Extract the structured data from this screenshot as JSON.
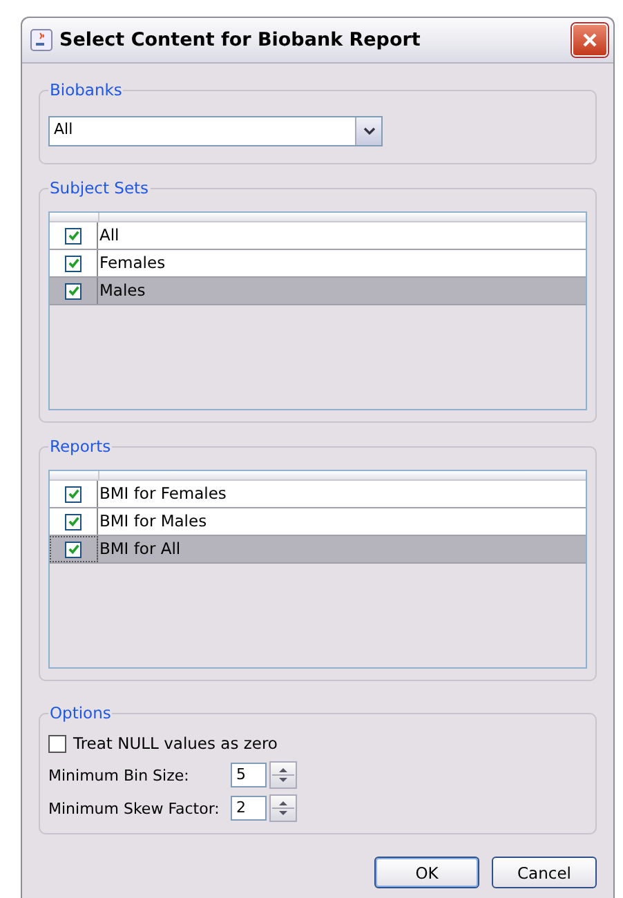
{
  "window": {
    "title": "Select Content for Biobank Report"
  },
  "biobanks": {
    "label": "Biobanks",
    "value": "All"
  },
  "subject_sets": {
    "label": "Subject Sets",
    "rows": [
      {
        "label": "All",
        "checked": true,
        "selected": false,
        "focused": false
      },
      {
        "label": "Females",
        "checked": true,
        "selected": false,
        "focused": false
      },
      {
        "label": "Males",
        "checked": true,
        "selected": true,
        "focused": false
      }
    ]
  },
  "reports": {
    "label": "Reports",
    "rows": [
      {
        "label": "BMI for Females",
        "checked": true,
        "selected": false,
        "focused": false
      },
      {
        "label": "BMI for Males",
        "checked": true,
        "selected": false,
        "focused": false
      },
      {
        "label": "BMI for All",
        "checked": true,
        "selected": true,
        "focused": true
      }
    ]
  },
  "options": {
    "label": "Options",
    "treat_null": {
      "label": "Treat NULL values as zero",
      "checked": false
    },
    "spinners": [
      {
        "label": "Minimum Bin Size:",
        "value": "5"
      },
      {
        "label": "Minimum Skew Factor:",
        "value": "2"
      }
    ]
  },
  "buttons": [
    "OK",
    "Cancel"
  ]
}
